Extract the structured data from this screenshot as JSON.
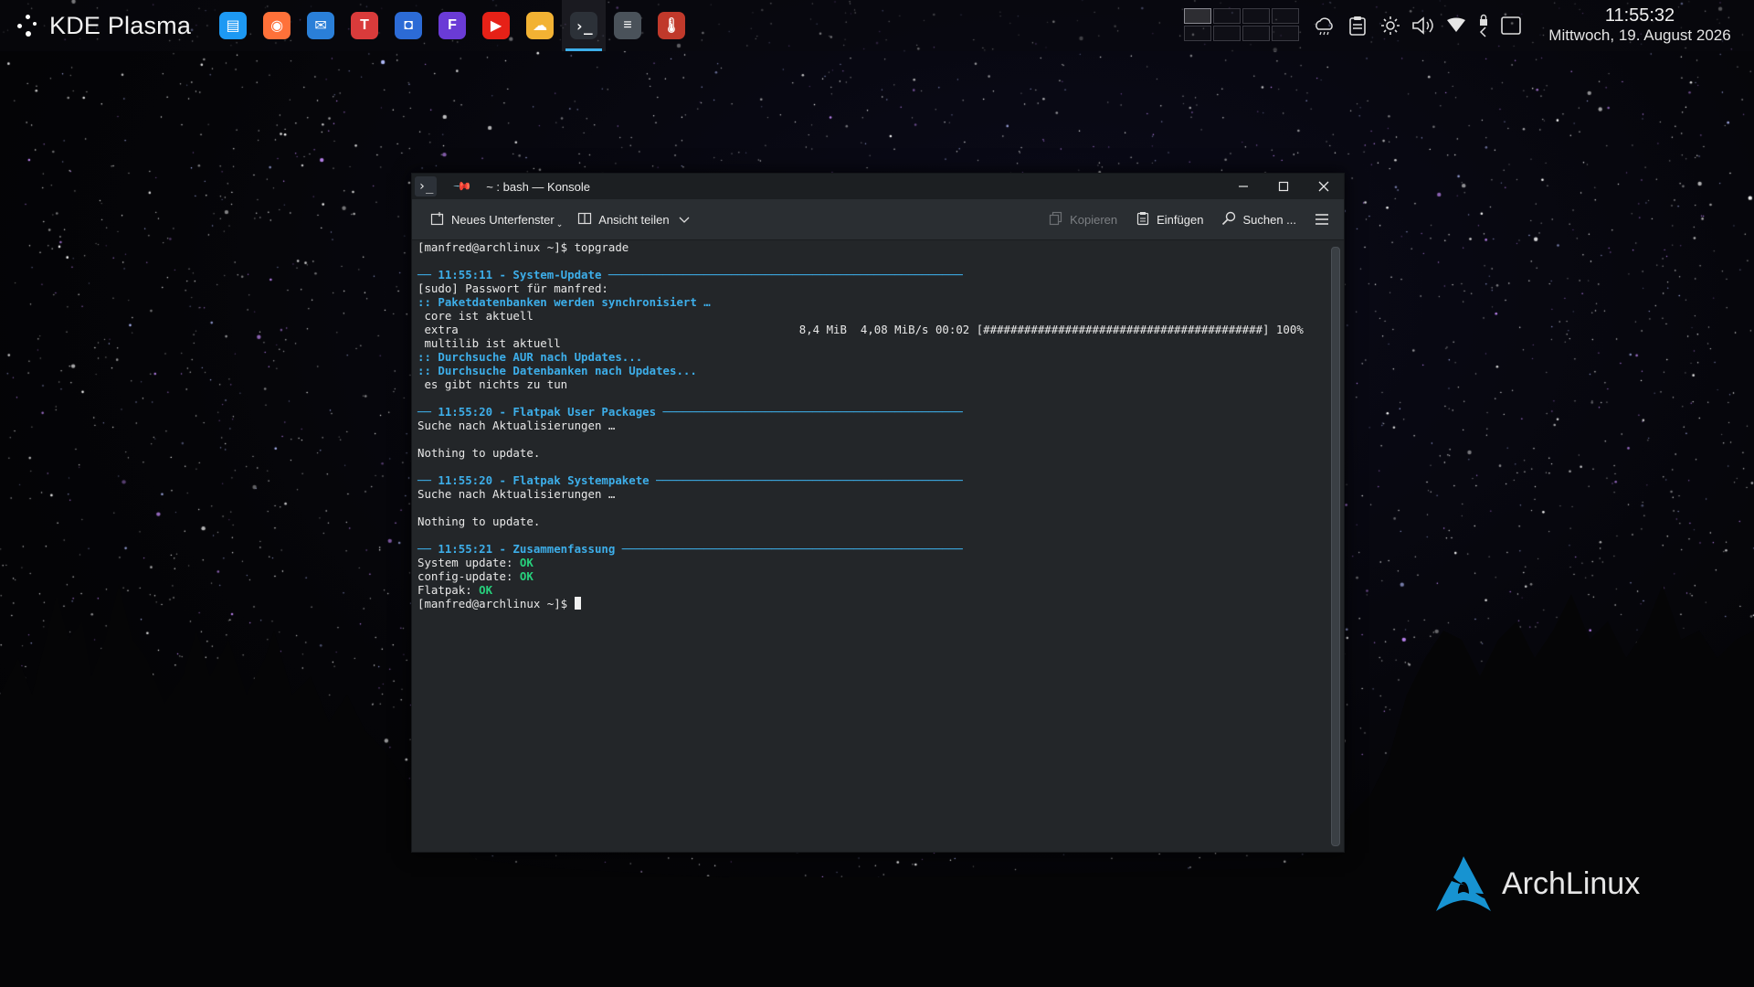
{
  "panel": {
    "launcher_label": "KDE Plasma",
    "tasks": [
      {
        "name": "dolphin",
        "icon": "folder-icon",
        "color": "#1d99f3",
        "glyph": "▤"
      },
      {
        "name": "firefox",
        "icon": "firefox-icon",
        "color": "#ff7139",
        "glyph": "◉"
      },
      {
        "name": "thunderbird",
        "icon": "thunderbird-icon",
        "color": "#2a7fd8",
        "glyph": "✉"
      },
      {
        "name": "app-red",
        "icon": "red-app-icon",
        "color": "#d93b3b",
        "glyph": "T"
      },
      {
        "name": "discover",
        "icon": "discover-bag-icon",
        "color": "#2c6bd6",
        "glyph": "◘"
      },
      {
        "name": "app-purple",
        "icon": "purple-app-icon",
        "color": "#6a3bd6",
        "glyph": "F"
      },
      {
        "name": "youtube",
        "icon": "youtube-icon",
        "color": "#e62117",
        "glyph": "▶"
      },
      {
        "name": "weather",
        "icon": "weather-cloud-icon",
        "color": "#f2b233",
        "glyph": "☁"
      },
      {
        "name": "konsole",
        "icon": "konsole-icon",
        "color": "#2c3138",
        "glyph": "›_"
      },
      {
        "name": "settings",
        "icon": "settings-sliders-icon",
        "color": "#4a525a",
        "glyph": "≡"
      },
      {
        "name": "thermometer",
        "icon": "thermometer-icon",
        "color": "#c0392b",
        "glyph": "🌡"
      }
    ],
    "tray_icons": [
      "weather-icon",
      "clipboard-icon",
      "brightness-icon",
      "volume-icon",
      "network-icon",
      "lock-icon",
      "show-desktop-icon"
    ],
    "clock": {
      "time": "11:55:32",
      "date": "Mittwoch, 19. August 2026"
    }
  },
  "window": {
    "title": "~ : bash — Konsole",
    "toolbar": {
      "new_tab": "Neues Unterfenster",
      "split_view": "Ansicht teilen",
      "copy": "Kopieren",
      "paste": "Einfügen",
      "search": "Suchen ..."
    },
    "terminal": {
      "lines": [
        {
          "text": "[manfred@archlinux ~]$ topgrade",
          "style": "plain"
        },
        {
          "text": "",
          "style": "plain"
        },
        {
          "text": "── 11:55:11 - System-Update ────────────────────────────────────────────────────",
          "style": "blue"
        },
        {
          "text": "[sudo] Passwort für manfred:",
          "style": "plain"
        },
        {
          "text": ":: Paketdatenbanken werden synchronisiert …",
          "style": "blue"
        },
        {
          "text": " core ist aktuell",
          "style": "plain"
        },
        {
          "text": " extra                                                  8,4 MiB  4,08 MiB/s 00:02 [#########################################] 100%",
          "style": "plain"
        },
        {
          "text": " multilib ist aktuell",
          "style": "plain"
        },
        {
          "text": ":: Durchsuche AUR nach Updates...",
          "style": "blue"
        },
        {
          "text": ":: Durchsuche Datenbanken nach Updates...",
          "style": "blue"
        },
        {
          "text": " es gibt nichts zu tun",
          "style": "plain"
        },
        {
          "text": "",
          "style": "plain"
        },
        {
          "text": "── 11:55:20 - Flatpak User Packages ────────────────────────────────────────────",
          "style": "blue"
        },
        {
          "text": "Suche nach Aktualisierungen …",
          "style": "plain"
        },
        {
          "text": "",
          "style": "plain"
        },
        {
          "text": "Nothing to update.",
          "style": "plain"
        },
        {
          "text": "",
          "style": "plain"
        },
        {
          "text": "── 11:55:20 - Flatpak Systempakete ─────────────────────────────────────────────",
          "style": "blue"
        },
        {
          "text": "Suche nach Aktualisierungen …",
          "style": "plain"
        },
        {
          "text": "",
          "style": "plain"
        },
        {
          "text": "Nothing to update.",
          "style": "plain"
        },
        {
          "text": "",
          "style": "plain"
        },
        {
          "text": "── 11:55:21 - Zusammenfassung ──────────────────────────────────────────────────",
          "style": "blue"
        }
      ],
      "summary": [
        {
          "label": "System update: ",
          "status": "OK"
        },
        {
          "label": "config-update: ",
          "status": "OK"
        },
        {
          "label": "Flatpak: ",
          "status": "OK"
        }
      ],
      "prompt": "[manfred@archlinux ~]$ "
    }
  },
  "desktop": {
    "logo_text": "ArchLinux",
    "accent_color": "#3daee9"
  }
}
